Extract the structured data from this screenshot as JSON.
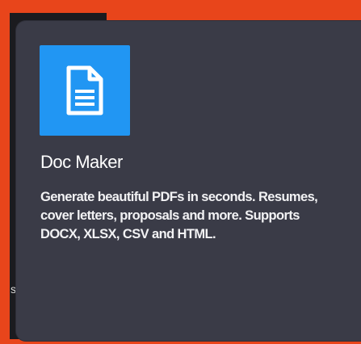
{
  "card": {
    "icon": "document-icon",
    "title": "Doc Maker",
    "description": "Generate beautiful PDFs in seconds. Resumes, cover letters, proposals and more. Supports DOCX, XLSX, CSV and HTML."
  },
  "background": {
    "peek_text": "s"
  },
  "colors": {
    "frame": "#e8451b",
    "card": "#3a3b47",
    "icon_bg": "#2196f3"
  }
}
